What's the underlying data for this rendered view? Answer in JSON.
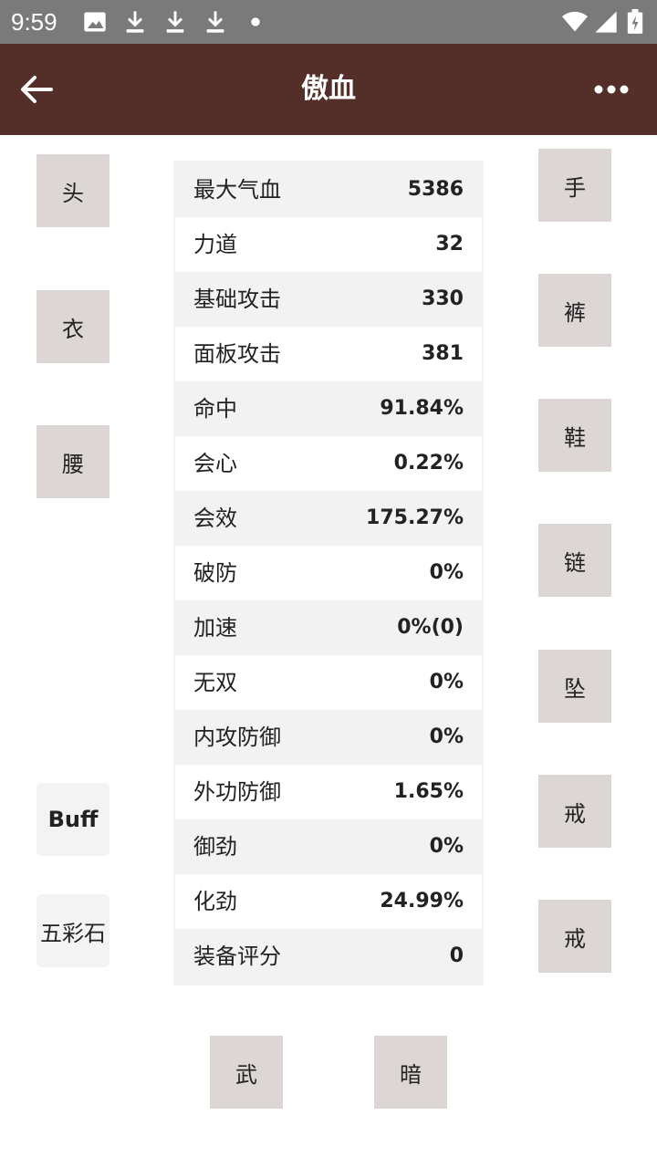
{
  "status_bar": {
    "time": "9:59",
    "icons": [
      "image-icon",
      "download-icon",
      "download-icon",
      "download-icon",
      "dot-icon",
      "wifi-icon",
      "signal-icon",
      "battery-icon"
    ]
  },
  "app_bar": {
    "title": "傲血",
    "back_icon": "arrow-left-icon",
    "more_icon": "more-horizontal-icon",
    "background": "#542f29"
  },
  "slots": {
    "head": "头",
    "clothes": "衣",
    "waist": "腰",
    "buff": "Buff",
    "five_color_stone": "五彩石",
    "hand": "手",
    "pants": "裤",
    "shoes": "鞋",
    "necklace": "链",
    "pendant": "坠",
    "ring1": "戒",
    "ring2": "戒",
    "weapon": "武",
    "hidden_weapon": "暗"
  },
  "stats": [
    {
      "label": "最大气血",
      "value": "5386"
    },
    {
      "label": "力道",
      "value": "32"
    },
    {
      "label": "基础攻击",
      "value": "330"
    },
    {
      "label": "面板攻击",
      "value": "381"
    },
    {
      "label": "命中",
      "value": "91.84%"
    },
    {
      "label": "会心",
      "value": "0.22%"
    },
    {
      "label": "会效",
      "value": "175.27%"
    },
    {
      "label": "破防",
      "value": "0%"
    },
    {
      "label": "加速",
      "value": "0%(0)"
    },
    {
      "label": "无双",
      "value": "0%"
    },
    {
      "label": "内攻防御",
      "value": "0%"
    },
    {
      "label": "外功防御",
      "value": "1.65%"
    },
    {
      "label": "御劲",
      "value": "0%"
    },
    {
      "label": "化劲",
      "value": "24.99%"
    },
    {
      "label": "装备评分",
      "value": "0"
    }
  ]
}
